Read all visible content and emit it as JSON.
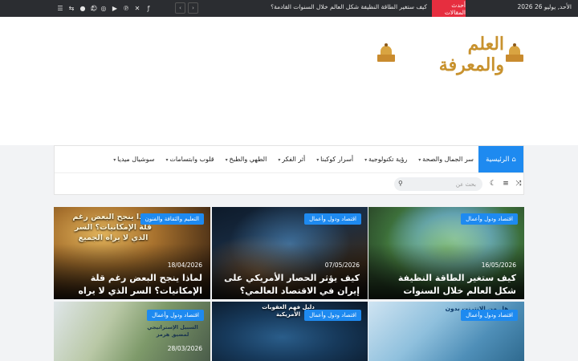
{
  "topbar": {
    "date": "الأحد, يوليو 26 2026",
    "breaking_label": "أحدث المقالات",
    "ticker_text": "كيف ستغير الطاقة النظيفة شكل العالم خلال السنوات القادمة؟",
    "prev_arrow": "‹",
    "next_arrow": "›",
    "social_icons": [
      "facebook-icon",
      "x-icon",
      "youtube-icon",
      "pinterest-icon",
      "instagram-icon",
      "tiktok-icon"
    ],
    "tool_icons": [
      "reddit-icon",
      "user-icon",
      "random-icon",
      "menu-icon"
    ]
  },
  "header": {
    "logo_text": "العلم والمعرفة"
  },
  "nav": {
    "home_label": "الرئيسية",
    "items": [
      {
        "label": "سر الجمال والصحة",
        "dropdown": true
      },
      {
        "label": "رؤية تكنولوجية",
        "dropdown": true
      },
      {
        "label": "أسرار كوكبنا",
        "dropdown": true
      },
      {
        "label": "أثر الفكر",
        "dropdown": true
      },
      {
        "label": "الطهي والطبخ",
        "dropdown": true
      },
      {
        "label": "قلوب وابتسامات",
        "dropdown": true
      },
      {
        "label": "سوشيال ميديا",
        "dropdown": true
      }
    ],
    "search_placeholder": "بحث عن",
    "row_icons": [
      "shuffle-icon",
      "list-icon",
      "moon-icon"
    ]
  },
  "cards": [
    {
      "category": "اقتصاد ودول وأعمال",
      "date": "16/05/2026",
      "title": "كيف ستغير الطاقة النظيفة شكل العالم خلال السنوات القادمة؟",
      "overlay": ""
    },
    {
      "category": "اقتصاد ودول وأعمال",
      "date": "07/05/2026",
      "title": "كيف يؤثر الحصار الأمريكي على إيران في الاقتصاد العالمي؟",
      "overlay": ""
    },
    {
      "category": "التعليم والثقافة والفنون",
      "date": "18/04/2026",
      "title": "لماذا ينجح البعض رغم قلة الإمكانيات؟ السر الذي لا يراه الجميع",
      "overlay": "لماذا ينجح البعض رغم قلة الإمكانيات؟ السر الذي لا يراه الجميع"
    },
    {
      "category": "اقتصاد ودول وأعمال",
      "date": "",
      "title": "",
      "overlay": "هل من الإنترنت بدون رأس مال؟"
    },
    {
      "category": "اقتصاد ودول وأعمال",
      "date": "",
      "title": "",
      "overlay": "دليل فهم العقوبات الأمريكية"
    },
    {
      "category": "اقتصاد ودول وأعمال",
      "date": "28/03/2026",
      "title": "",
      "overlay": "السبيل الإستراتيجي لمضيق هرمز"
    }
  ],
  "colors": {
    "accent": "#1e8af0",
    "breaking": "#e62e3f",
    "topbar_bg": "#2b2d31",
    "logo_gold": "#c8922e"
  }
}
